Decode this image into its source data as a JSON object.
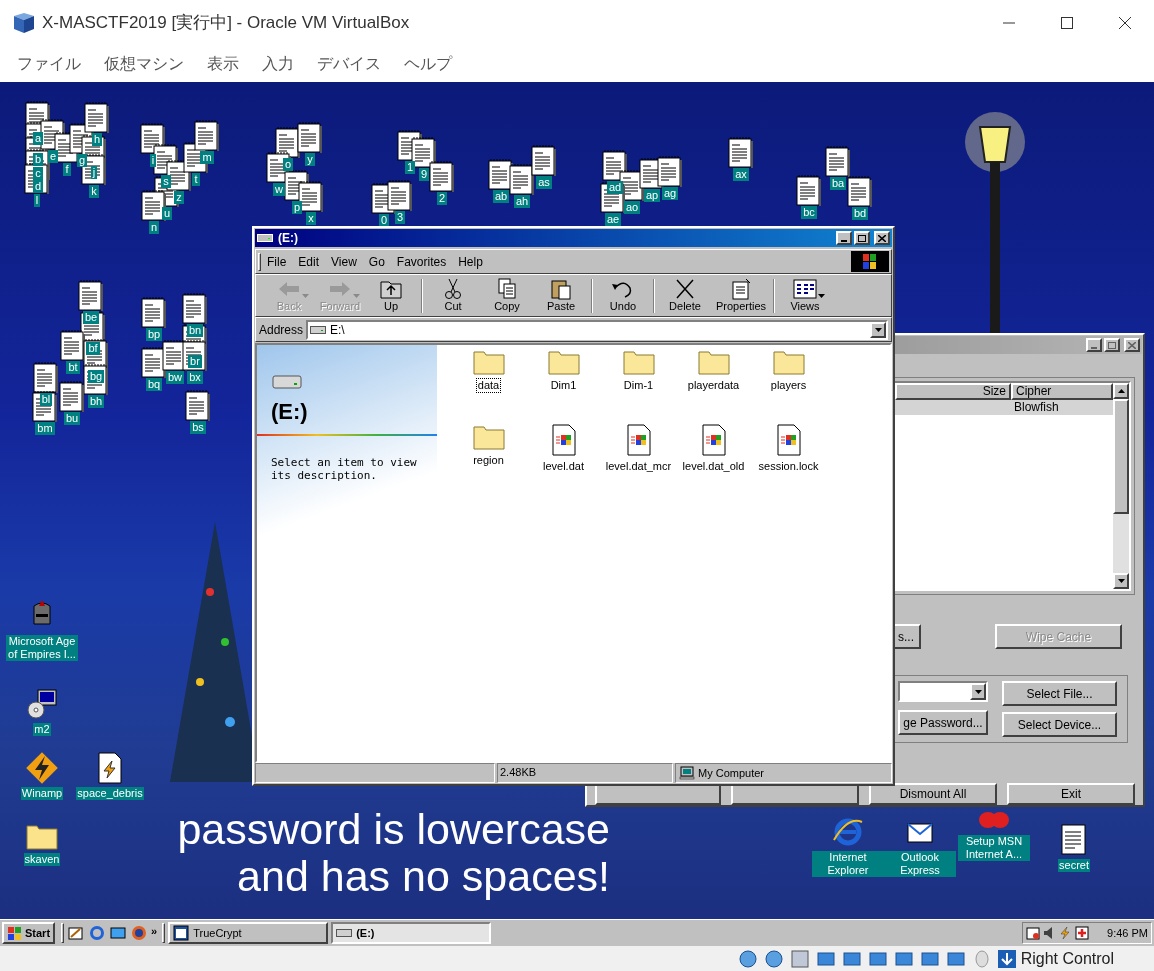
{
  "window": {
    "title": "X-MASCTF2019 [実行中] - Oracle VM VirtualBox",
    "menu": [
      "ファイル",
      "仮想マシン",
      "表示",
      "入力",
      "デバイス",
      "ヘルプ"
    ]
  },
  "desktop": {
    "file_icons": [
      {
        "label": "a"
      },
      {
        "label": "b"
      },
      {
        "label": "c"
      },
      {
        "label": "d"
      },
      {
        "label": "l"
      },
      {
        "label": "e"
      },
      {
        "label": "f"
      },
      {
        "label": "g"
      },
      {
        "label": "h"
      },
      {
        "label": "j"
      },
      {
        "label": "k"
      },
      {
        "label": "i"
      },
      {
        "label": "s"
      },
      {
        "label": "u"
      },
      {
        "label": "z"
      },
      {
        "label": "t"
      },
      {
        "label": "m"
      },
      {
        "label": "n"
      },
      {
        "label": "o"
      },
      {
        "label": "y"
      },
      {
        "label": "w"
      },
      {
        "label": "p"
      },
      {
        "label": "x"
      },
      {
        "label": "1"
      },
      {
        "label": "9"
      },
      {
        "label": "2"
      },
      {
        "label": "0"
      },
      {
        "label": "3"
      },
      {
        "label": "ab"
      },
      {
        "label": "ah"
      },
      {
        "label": "as"
      },
      {
        "label": "ad"
      },
      {
        "label": "ao"
      },
      {
        "label": "ap"
      },
      {
        "label": "ag"
      },
      {
        "label": "ae"
      },
      {
        "label": "ax"
      },
      {
        "label": "ba"
      },
      {
        "label": "bc"
      },
      {
        "label": "bd"
      },
      {
        "label": "be"
      },
      {
        "label": "bf"
      },
      {
        "label": "bt"
      },
      {
        "label": "bg"
      },
      {
        "label": "bl"
      },
      {
        "label": "bh"
      },
      {
        "label": "bm"
      },
      {
        "label": "bu"
      },
      {
        "label": "bp"
      },
      {
        "label": "bn"
      },
      {
        "label": "br"
      },
      {
        "label": "bq"
      },
      {
        "label": "bw"
      },
      {
        "label": "bx"
      },
      {
        "label": "bs"
      }
    ],
    "shortcuts": [
      {
        "label": "Microsoft Age of Empires I...",
        "kind": "helmet"
      },
      {
        "label": "m2",
        "kind": "installer"
      },
      {
        "label": "Winamp",
        "kind": "winamp"
      },
      {
        "label": "space_debris",
        "kind": "winamp-file"
      },
      {
        "label": "skaven",
        "kind": "folder"
      },
      {
        "label": "Internet Explorer",
        "kind": "ie"
      },
      {
        "label": "Outlook Express",
        "kind": "outlook"
      },
      {
        "label": "Setup MSN Internet A...",
        "kind": "msn"
      },
      {
        "label": "secret",
        "kind": "text"
      }
    ],
    "wallpaper_text": [
      "password is lowercase",
      "and has no spaces!"
    ]
  },
  "truecrypt": {
    "columns": [
      "Size",
      "Cipher"
    ],
    "rows": [
      {
        "cipher": "Blowfish",
        "selected": true
      }
    ],
    "buttons": [
      {
        "label": "s...",
        "disabled": false
      },
      {
        "label": "Wipe Cache",
        "disabled": true
      }
    ],
    "select_buttons": [
      {
        "label": "ge Password...",
        "disabled": false
      },
      {
        "label": "Select File...",
        "disabled": false
      },
      {
        "label": "Select Device...",
        "disabled": false
      }
    ],
    "bottom_buttons": [
      {
        "label": "Dismount All",
        "disabled": false
      },
      {
        "label": "Exit",
        "disabled": false
      }
    ]
  },
  "explorer": {
    "title": "(E:)",
    "menu": [
      "File",
      "Edit",
      "View",
      "Go",
      "Favorites",
      "Help"
    ],
    "toolbar": [
      {
        "label": "Back",
        "kind": "back",
        "disabled": true
      },
      {
        "label": "Forward",
        "kind": "forward",
        "disabled": true
      },
      {
        "label": "Up",
        "kind": "up",
        "disabled": false
      },
      {
        "label": "Cut",
        "kind": "cut",
        "disabled": false
      },
      {
        "label": "Copy",
        "kind": "copy",
        "disabled": false
      },
      {
        "label": "Paste",
        "kind": "paste",
        "disabled": false
      },
      {
        "label": "Undo",
        "kind": "undo",
        "disabled": false
      },
      {
        "label": "Delete",
        "kind": "delete",
        "disabled": false
      },
      {
        "label": "Properties",
        "kind": "properties",
        "disabled": false
      },
      {
        "label": "Views",
        "kind": "views",
        "disabled": false
      }
    ],
    "address_label": "Address",
    "address": "E:\\",
    "pane_title": "(E:)",
    "pane_text": "Select an item to view its description.",
    "items": [
      {
        "name": "data",
        "kind": "folder",
        "selected": true
      },
      {
        "name": "Dim1",
        "kind": "folder",
        "selected": false
      },
      {
        "name": "Dim-1",
        "kind": "folder",
        "selected": false
      },
      {
        "name": "playerdata",
        "kind": "folder",
        "selected": false
      },
      {
        "name": "players",
        "kind": "folder",
        "selected": false
      },
      {
        "name": "region",
        "kind": "folder",
        "selected": false
      },
      {
        "name": "level.dat",
        "kind": "file",
        "selected": false
      },
      {
        "name": "level.dat_mcr",
        "kind": "file",
        "selected": false
      },
      {
        "name": "level.dat_old",
        "kind": "file",
        "selected": false
      },
      {
        "name": "session.lock",
        "kind": "file",
        "selected": false
      }
    ],
    "status": [
      "2.48KB",
      "My Computer"
    ]
  },
  "taskbar": {
    "start": "Start",
    "tasks": [
      {
        "label": "TrueCrypt",
        "kind": "app",
        "selected": false
      },
      {
        "label": "(E:)",
        "kind": "drive",
        "selected": true
      }
    ],
    "more": "»",
    "clock": "9:46 PM"
  },
  "host_status": {
    "hotkey": "Right Control"
  }
}
